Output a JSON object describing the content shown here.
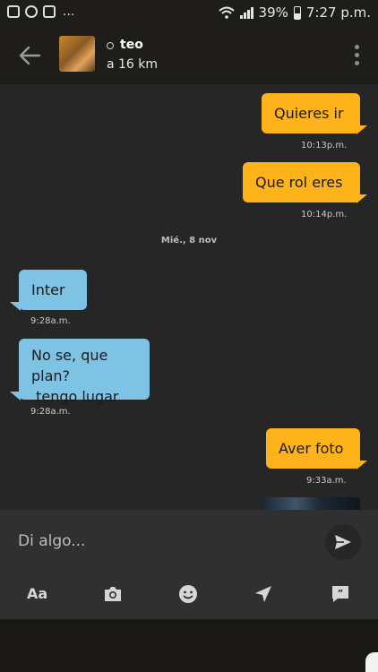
{
  "status_bar": {
    "icons": [
      "gallery-icon",
      "whatsapp-icon",
      "instagram-icon"
    ],
    "more": "...",
    "battery": "39%",
    "time": "7:27 p.m."
  },
  "header": {
    "contact_name": "teo",
    "distance": "a 16 km"
  },
  "conversation": {
    "day_separator": "Mié., 8 nov",
    "messages": [
      {
        "direction": "out",
        "text": "Quieres ir",
        "time": "10:13p.m."
      },
      {
        "direction": "out",
        "text": "Que rol eres",
        "time": "10:14p.m."
      },
      {
        "direction": "in",
        "text": "Inter",
        "time": "9:28a.m."
      },
      {
        "direction": "in",
        "text_line1": "No se, que plan?",
        "text_line2": " tengo lugar",
        "time": "9:28a.m."
      },
      {
        "direction": "out",
        "text": "Aver foto",
        "time": "9:33a.m."
      }
    ]
  },
  "composer": {
    "placeholder": "Di algo...",
    "tools": [
      "text-format-icon",
      "camera-icon",
      "emoji-icon",
      "location-icon",
      "saved-phrases-icon"
    ],
    "text_format_label": "Aa"
  },
  "colors": {
    "outgoing_bubble": "#ffb31a",
    "incoming_bubble": "#7ec3e3",
    "background": "#262626"
  }
}
